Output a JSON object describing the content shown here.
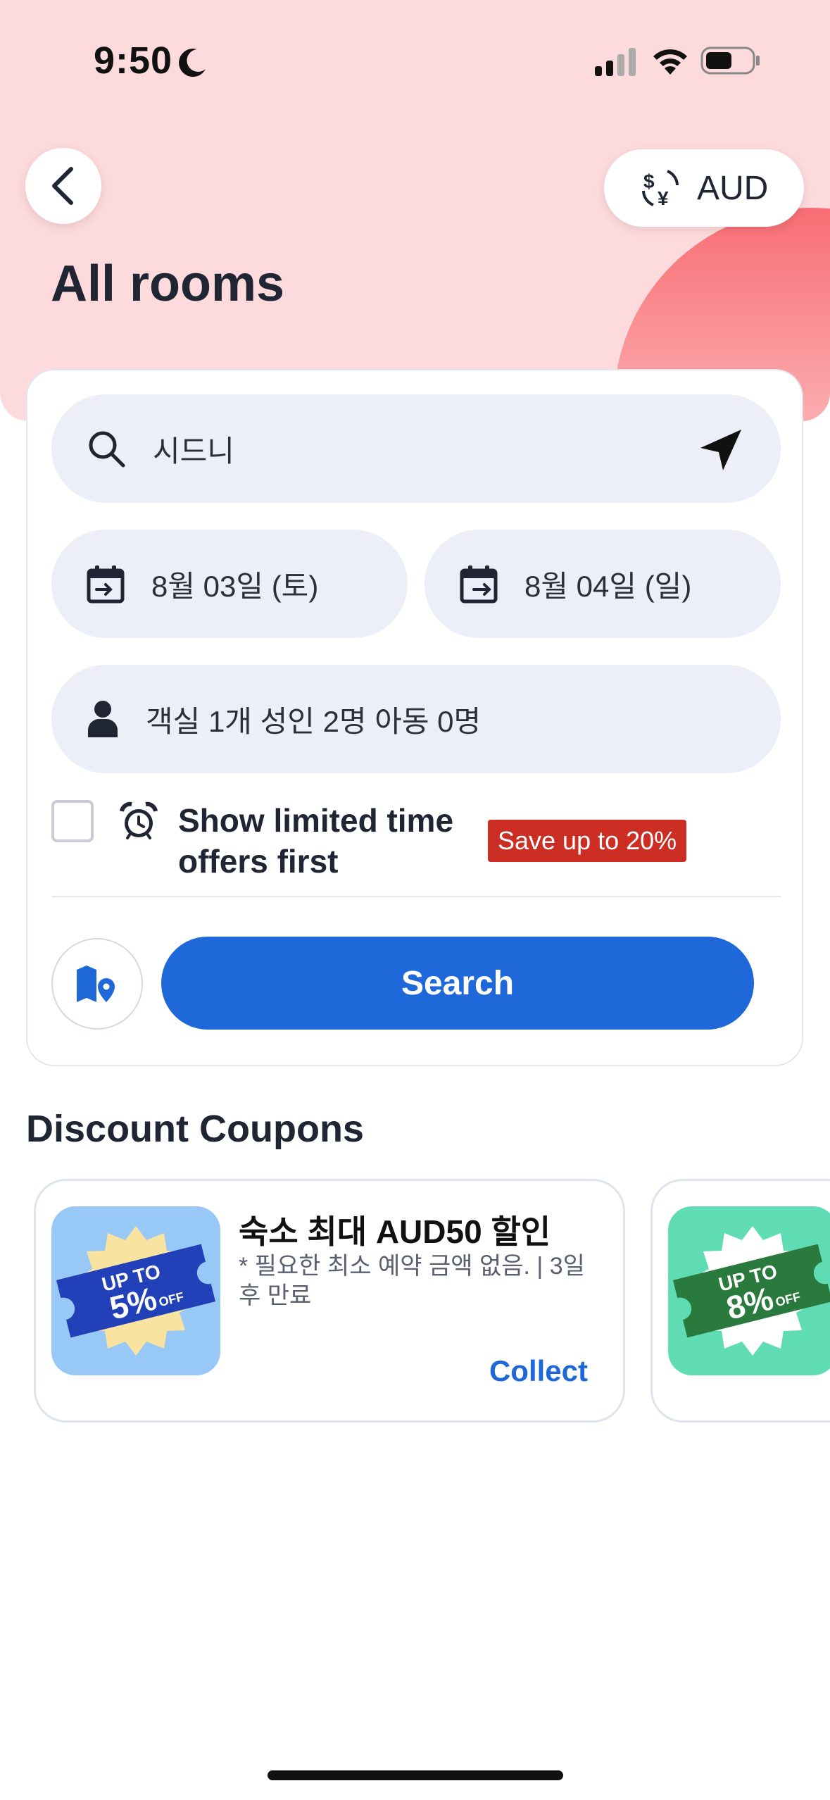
{
  "status_bar": {
    "time": "9:50"
  },
  "header": {
    "currency": "AUD",
    "title": "All rooms"
  },
  "search": {
    "destination": "시드니",
    "checkin": "8월 03일 (토)",
    "checkout": "8월 04일 (일)",
    "guests": "객실 1개 성인 2명 아동 0명",
    "limited_offer_label": "Show limited time offers first",
    "limited_offer_checked": false,
    "save_badge": "Save up to 20%",
    "search_button": "Search"
  },
  "coupons": {
    "heading": "Discount Coupons",
    "items": [
      {
        "title": "숙소 최대 AUD50 할인",
        "description": "* 필요한 최소 예약 금액 없음.  | 3일 후 만료",
        "action": "Collect",
        "badge_top": "UP TO",
        "badge_value": "5%",
        "badge_bottom": "OFF"
      },
      {
        "badge_top": "UP TO",
        "badge_value": "8%",
        "badge_bottom": "OFF"
      }
    ]
  },
  "colors": {
    "primary": "#1f68d9",
    "hero_background": "#fddadb",
    "save_badge": "#cc2e24"
  }
}
